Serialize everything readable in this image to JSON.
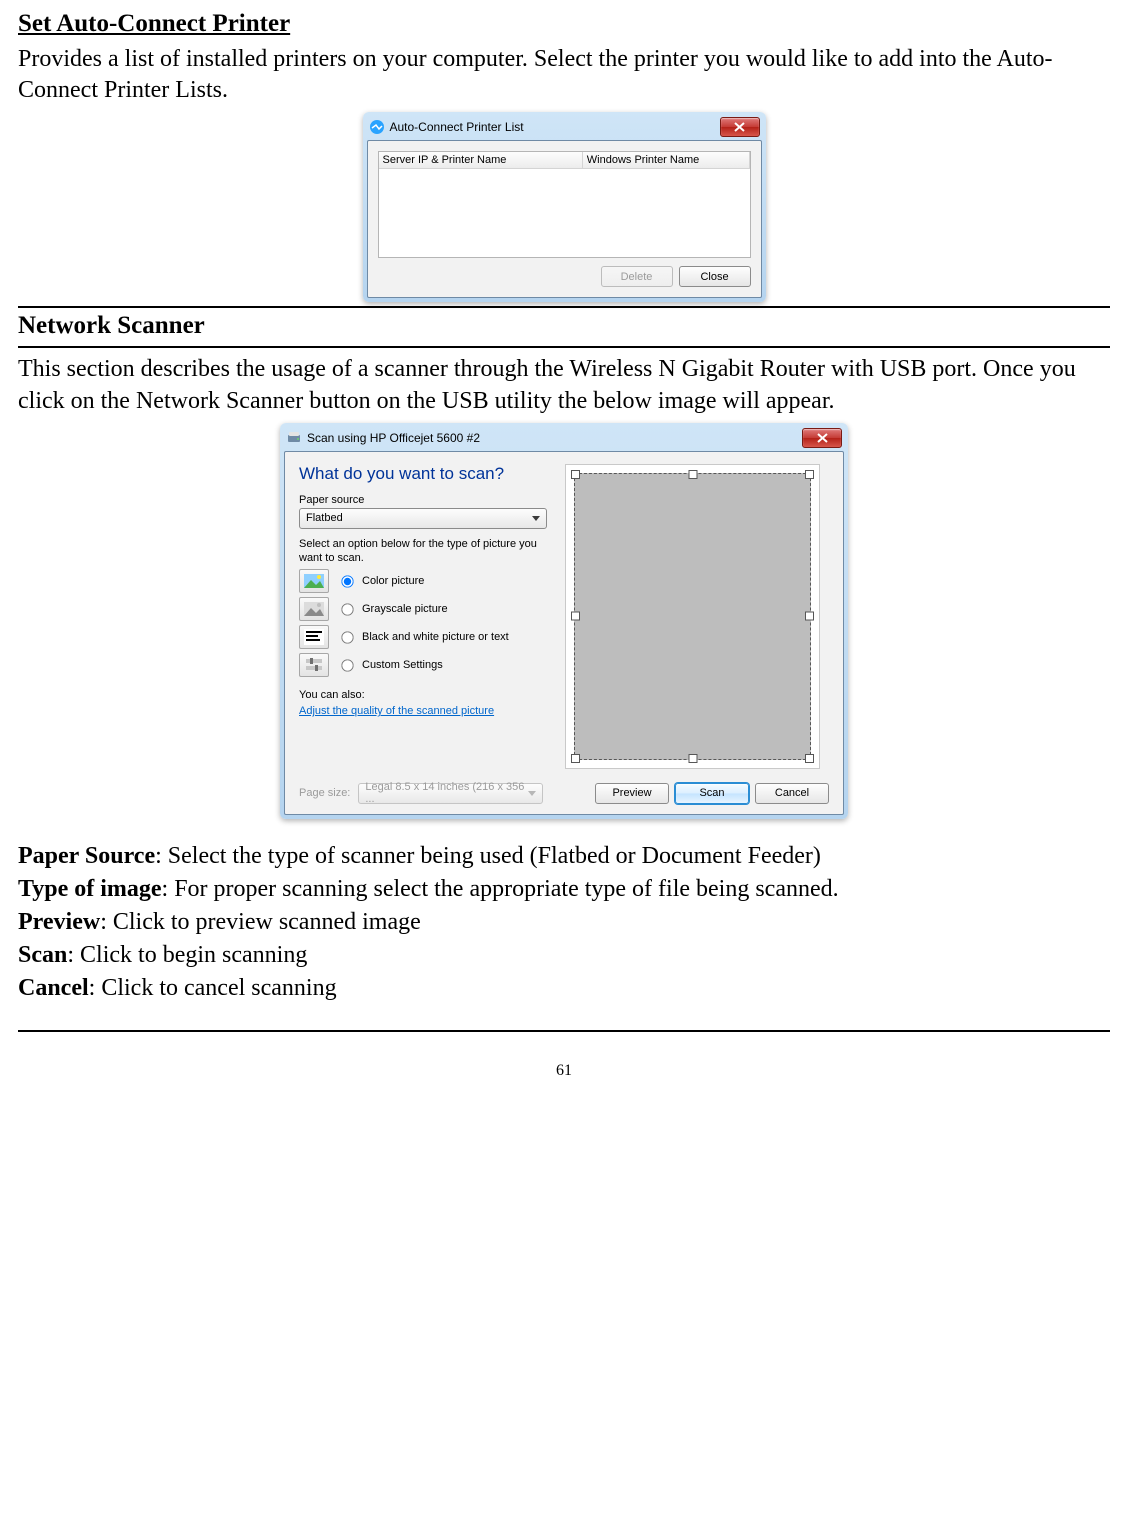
{
  "section1": {
    "title": "Set Auto-Connect Printer",
    "body": "Provides a list of installed printers on your computer. Select the printer you would like to add into the Auto-Connect Printer Lists."
  },
  "dlg1": {
    "title": "Auto-Connect Printer List",
    "columns": {
      "c1": "Server IP & Printer Name",
      "c2": "Windows Printer Name"
    },
    "buttons": {
      "delete": "Delete",
      "close": "Close"
    }
  },
  "section2": {
    "title": "Network Scanner",
    "body": "This section describes the usage of a scanner through the Wireless N Gigabit Router with USB port. Once you click on the Network Scanner button on the USB utility the below image will appear."
  },
  "dlg2": {
    "title": "Scan using HP Officejet 5600 #2",
    "heading": "What do you want to scan?",
    "paper_source_label": "Paper source",
    "paper_source_value": "Flatbed",
    "options_hint": "Select an option below for the type of picture you want to scan.",
    "options": {
      "color": "Color picture",
      "gray": "Grayscale picture",
      "bw": "Black and white picture or text",
      "custom": "Custom Settings"
    },
    "you_can_also_label": "You can also:",
    "adjust_link": "Adjust the quality of the scanned picture",
    "page_size_label": "Page size:",
    "page_size_value": "Legal 8.5 x 14 inches (216 x 356 ...",
    "buttons": {
      "preview": "Preview",
      "scan": "Scan",
      "cancel": "Cancel"
    }
  },
  "defs": {
    "paper_source": {
      "term": "Paper Source",
      "text": ": Select the type of scanner being used (Flatbed or Document Feeder)"
    },
    "type_of_image": {
      "term": "Type of image",
      "text": ": For proper scanning select the appropriate type of file being scanned."
    },
    "preview": {
      "term": "Preview",
      "text": ": Click to preview scanned image"
    },
    "scan": {
      "term": "Scan",
      "text": ": Click to begin scanning"
    },
    "cancel": {
      "term": "Cancel",
      "text": ": Click to cancel scanning"
    }
  },
  "page_number": "61"
}
